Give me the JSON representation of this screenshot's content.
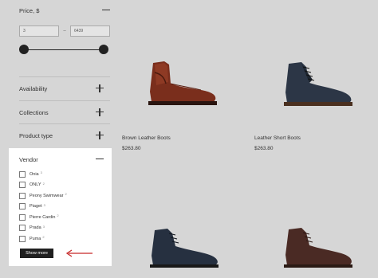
{
  "filters": {
    "price": {
      "label": "Price, $",
      "min_value": "3",
      "max_value": "6439",
      "separator": "–"
    },
    "sections": [
      {
        "label": "Availability"
      },
      {
        "label": "Collections"
      },
      {
        "label": "Product type"
      }
    ],
    "vendor": {
      "label": "Vendor",
      "items": [
        {
          "label": "Onia",
          "count": "3"
        },
        {
          "label": "ONLY",
          "count": "2"
        },
        {
          "label": "Peony Swimwear",
          "count": "2"
        },
        {
          "label": "Piaget",
          "count": "3"
        },
        {
          "label": "Pierre Cardin",
          "count": "2"
        },
        {
          "label": "Prada",
          "count": "3"
        },
        {
          "label": "Puma",
          "count": "2"
        }
      ],
      "show_more_label": "Show more"
    }
  },
  "products": [
    {
      "title": "Brown Leather Boots",
      "price": "$263.80",
      "image": "brown-chelsea-boot"
    },
    {
      "title": "Leather Short Boots",
      "price": "$263.80",
      "image": "navy-lace-up-boot"
    },
    {
      "title": "",
      "price": "",
      "image": "navy-chukka-boot"
    },
    {
      "title": "",
      "price": "",
      "image": "brown-chukka-boot"
    }
  ],
  "colors": {
    "background": "#d6d6d6",
    "panel": "#ffffff",
    "accent_arrow": "#c62828",
    "button": "#1f1f1f"
  }
}
